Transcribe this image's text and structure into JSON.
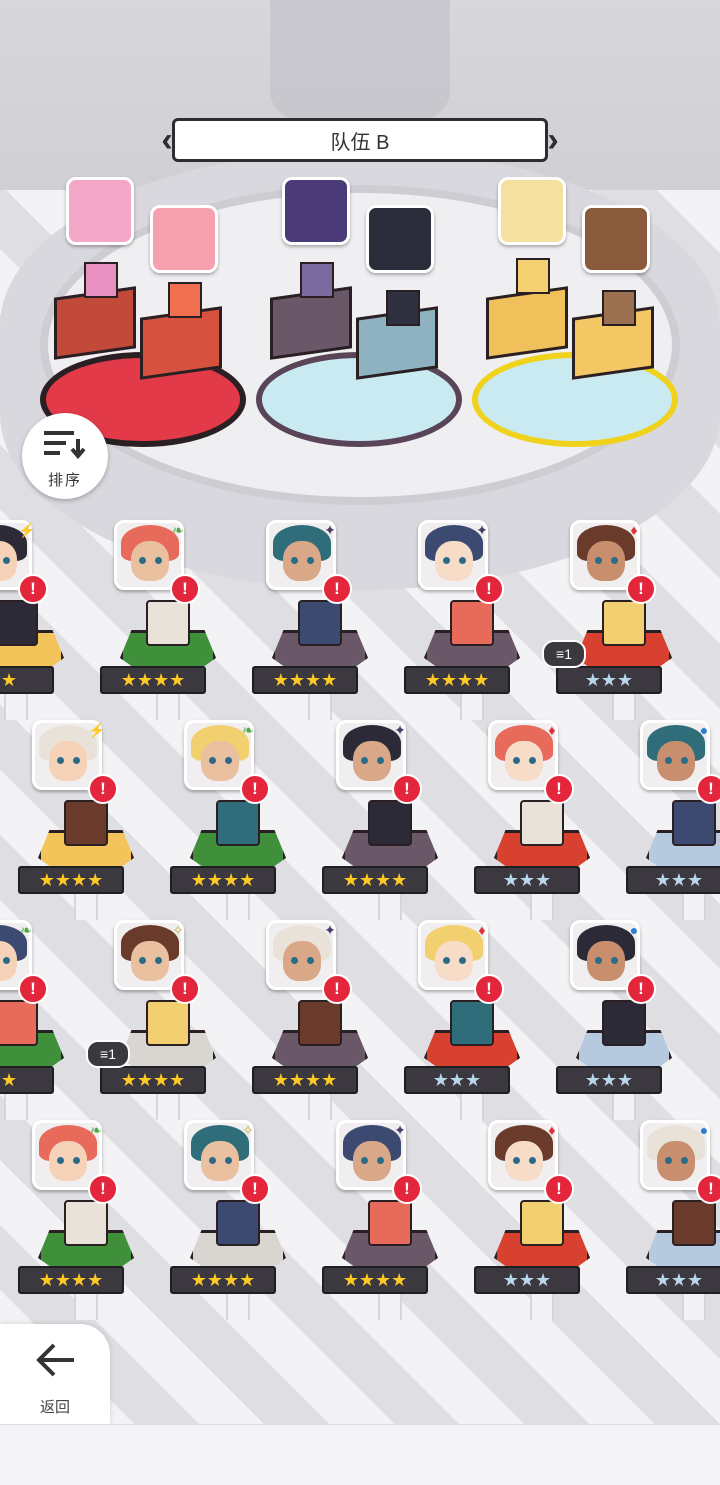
{
  "team": {
    "title": "队伍 B",
    "prev_label": "‹",
    "next_label": "›"
  },
  "controls": {
    "sort_label": "排序",
    "back_label": "返回"
  },
  "colors": {
    "fire": "#d8412f",
    "dark": "#6a5868",
    "light": "#f2c45a",
    "wind": "#3f8f3b",
    "water": "#b7c9de",
    "stone": "#d9d6d2"
  },
  "team_slots": [
    {
      "group": "fire",
      "element": "fire"
    },
    {
      "group": "dark",
      "element": "water"
    },
    {
      "group": "light",
      "element": "light"
    }
  ],
  "heroes": [
    {
      "element": "light",
      "stars": "★★",
      "star_type": "gold",
      "alert": "!"
    },
    {
      "element": "wind",
      "stars": "★★★★",
      "star_type": "gold",
      "alert": "!"
    },
    {
      "element": "dark",
      "stars": "★★★★",
      "star_type": "gold",
      "alert": "!"
    },
    {
      "element": "dark",
      "stars": "★★★★",
      "star_type": "gold",
      "alert": "!"
    },
    {
      "element": "fire",
      "stars": "★★★",
      "star_type": "silver",
      "alert": "!",
      "dupes": "1"
    },
    {
      "element": "light",
      "stars": "★★★★",
      "star_type": "gold",
      "alert": "!"
    },
    {
      "element": "wind",
      "stars": "★★★★",
      "star_type": "gold",
      "alert": "!"
    },
    {
      "element": "dark",
      "stars": "★★★★",
      "star_type": "gold",
      "alert": "!"
    },
    {
      "element": "fire",
      "stars": "★★★",
      "star_type": "silver",
      "alert": "!"
    },
    {
      "element": "water",
      "stars": "★★★",
      "star_type": "silver",
      "alert": "!"
    },
    {
      "element": "wind",
      "stars": "★★",
      "star_type": "gold",
      "alert": "!"
    },
    {
      "element": "stone",
      "stars": "★★★★",
      "star_type": "gold",
      "alert": "!",
      "dupes": "1"
    },
    {
      "element": "dark",
      "stars": "★★★★",
      "star_type": "gold",
      "alert": "!"
    },
    {
      "element": "fire",
      "stars": "★★★",
      "star_type": "silver",
      "alert": "!"
    },
    {
      "element": "water",
      "stars": "★★★",
      "star_type": "silver",
      "alert": "!"
    },
    {
      "element": "wind",
      "stars": "★★★★",
      "star_type": "gold",
      "alert": "!"
    },
    {
      "element": "stone",
      "stars": "★★★★",
      "star_type": "gold",
      "alert": "!"
    },
    {
      "element": "dark",
      "stars": "★★★★",
      "star_type": "gold",
      "alert": "!"
    },
    {
      "element": "fire",
      "stars": "★★★",
      "star_type": "silver",
      "alert": "!"
    },
    {
      "element": "water",
      "stars": "★★★",
      "star_type": "silver",
      "alert": "!"
    }
  ]
}
